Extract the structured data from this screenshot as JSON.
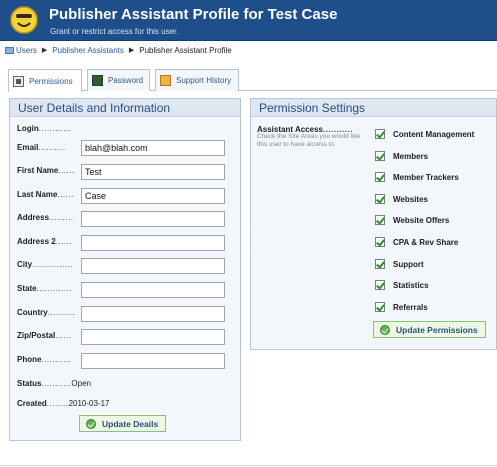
{
  "header": {
    "title": "Publisher Assistant Profile for Test Case",
    "subtitle": "Grant or restrict access for this user.",
    "logo_icon": "smiley-face-icon"
  },
  "breadcrumb": {
    "items": [
      "Users",
      "Publisher Assistants"
    ],
    "current": "Publisher Assistant Profile",
    "separator": "▶"
  },
  "tabs": [
    {
      "label": "Permissions",
      "icon": "permissions-icon",
      "active": true
    },
    {
      "label": "Password",
      "icon": "password-icon",
      "active": false
    },
    {
      "label": "Support History",
      "icon": "support-history-icon",
      "active": false
    }
  ],
  "user_panel": {
    "title": "User Details and Information",
    "fields": {
      "login": {
        "label": "Login",
        "dots": "............",
        "value": ""
      },
      "email": {
        "label": "Email",
        "dots": "..........",
        "value": "blah@blah.com"
      },
      "first_name": {
        "label": "First Name",
        "dots": "......",
        "value": "Test"
      },
      "last_name": {
        "label": "Last Name",
        "dots": "......",
        "value": "Case"
      },
      "address": {
        "label": "Address",
        "dots": ".........",
        "value": ""
      },
      "address2": {
        "label": "Address 2",
        "dots": "......",
        "value": ""
      },
      "city": {
        "label": "City",
        "dots": "...............",
        "value": ""
      },
      "state": {
        "label": "State",
        "dots": ".............",
        "value": ""
      },
      "country": {
        "label": "Country",
        "dots": "..........",
        "value": ""
      },
      "zip": {
        "label": "Zip/Postal",
        "dots": "......",
        "value": ""
      },
      "phone": {
        "label": "Phone",
        "dots": "...........",
        "value": ""
      },
      "status": {
        "label": "Status",
        "dots": "...........",
        "value": "Open"
      },
      "created": {
        "label": "Created",
        "dots": "........",
        "value": "2010-03-17"
      }
    },
    "button": "Update Deails"
  },
  "permission_panel": {
    "title": "Permission Settings",
    "access_label": "Assistant Access",
    "access_dots": "...........",
    "help": "Check the Site Areas you would like this user to have access to.",
    "items": [
      {
        "label": "Content Management",
        "checked": true
      },
      {
        "label": "Members",
        "checked": true
      },
      {
        "label": "Member Trackers",
        "checked": true
      },
      {
        "label": "Websites",
        "checked": true
      },
      {
        "label": "Website Offers",
        "checked": true
      },
      {
        "label": "CPA & Rev Share",
        "checked": true
      },
      {
        "label": "Support",
        "checked": true
      },
      {
        "label": "Statistics",
        "checked": true
      },
      {
        "label": "Referrals",
        "checked": true
      }
    ],
    "button": "Update Permissions"
  },
  "colors": {
    "header_bg": "#1f4f8b",
    "panel_head_bg": "#dde6f1",
    "button_bg": "#ecf7e4",
    "check_green": "#2f8a2f"
  }
}
